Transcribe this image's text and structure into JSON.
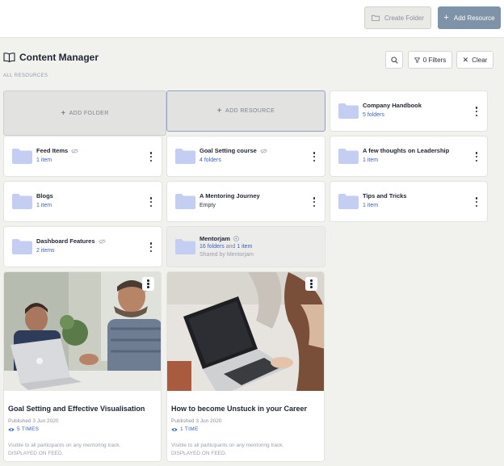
{
  "header": {
    "create_folder_label": "Create Folder",
    "add_resource_label": "Add Resource"
  },
  "page": {
    "title": "Content Manager",
    "breadcrumb": "ALL RESOURCES"
  },
  "toolbar": {
    "filters_label": "0 Filters",
    "clear_label": "Clear"
  },
  "add_cards": {
    "folder_label": "ADD FOLDER",
    "resource_label": "ADD RESOURCE"
  },
  "folders": [
    {
      "name": "Company Handbook",
      "sub": "5 folders"
    },
    {
      "name": "Feed Items",
      "sub": "1 item"
    },
    {
      "name": "Goal Setting course",
      "sub": "4 folders"
    },
    {
      "name": "A few thoughts on Leadership",
      "sub": "1 item"
    },
    {
      "name": "Blogs",
      "sub": "1 item"
    },
    {
      "name": "A Mentoring Journey",
      "sub": "Empty"
    },
    {
      "name": "Tips and Tricks",
      "sub": "1 item"
    },
    {
      "name": "Dashboard Features",
      "sub": "2 items"
    },
    {
      "name": "Mentorjam",
      "sub_a": "16 folders",
      "sub_and": "and",
      "sub_b": "1 item",
      "sub2": "Shared by Mentorjam"
    }
  ],
  "resources": [
    {
      "title": "Goal Setting and Effective Visualisation",
      "published": "Published 3 Jun 2020",
      "views": "5 TIMES",
      "visibility_line1": "Visible to all participants on any mentoring track.",
      "visibility_line2": "DISPLAYED ON FEED."
    },
    {
      "title": "How to become Unstuck in your Career",
      "published": "Published 3 Jun 2020",
      "views": "1 TIME",
      "visibility_line1": "Visible to all participants on any mentoring track.",
      "visibility_line2": "DISPLAYED ON FEED."
    }
  ],
  "colors": {
    "accent_blue": "#3b62b5",
    "add_resource_button": "#7f93a8",
    "folder_icon": "#c3cef2",
    "background": "#f1f1ee"
  },
  "icons": [
    "folder-icon",
    "plus-icon",
    "book-icon",
    "search-icon",
    "filter-icon",
    "close-icon",
    "kebab-icon",
    "hidden-eye-icon",
    "shared-icon",
    "eye-icon"
  ]
}
